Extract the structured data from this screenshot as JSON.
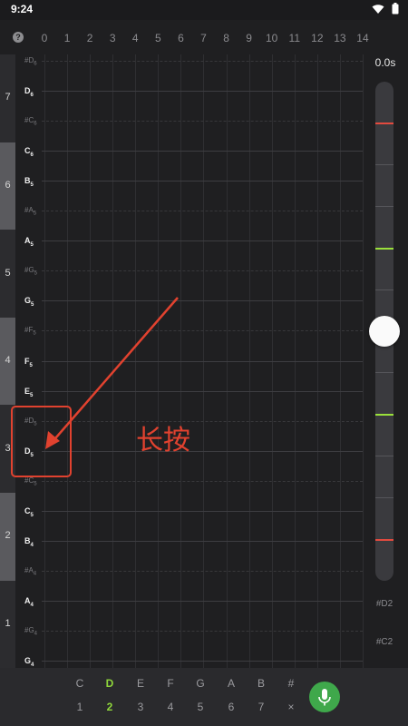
{
  "status_bar": {
    "time": "9:24"
  },
  "fret_header": {
    "help": "?",
    "frets": [
      "0",
      "1",
      "2",
      "3",
      "4",
      "5",
      "6",
      "7",
      "8",
      "9",
      "10",
      "11",
      "12",
      "13",
      "14"
    ]
  },
  "octaves": [
    "7",
    "6",
    "5",
    "4",
    "3",
    "2",
    "1"
  ],
  "notes": [
    {
      "name": "#D",
      "octave": "6",
      "sharp": true
    },
    {
      "name": "D",
      "octave": "6",
      "sharp": false
    },
    {
      "name": "#C",
      "octave": "6",
      "sharp": true
    },
    {
      "name": "C",
      "octave": "6",
      "sharp": false
    },
    {
      "name": "B",
      "octave": "5",
      "sharp": false
    },
    {
      "name": "#A",
      "octave": "5",
      "sharp": true
    },
    {
      "name": "A",
      "octave": "5",
      "sharp": false
    },
    {
      "name": "#G",
      "octave": "5",
      "sharp": true
    },
    {
      "name": "G",
      "octave": "5",
      "sharp": false
    },
    {
      "name": "#F",
      "octave": "5",
      "sharp": true
    },
    {
      "name": "F",
      "octave": "5",
      "sharp": false
    },
    {
      "name": "E",
      "octave": "5",
      "sharp": false
    },
    {
      "name": "#D",
      "octave": "5",
      "sharp": true
    },
    {
      "name": "D",
      "octave": "5",
      "sharp": false
    },
    {
      "name": "#C",
      "octave": "5",
      "sharp": true
    },
    {
      "name": "C",
      "octave": "5",
      "sharp": false
    },
    {
      "name": "B",
      "octave": "4",
      "sharp": false
    },
    {
      "name": "#A",
      "octave": "4",
      "sharp": true
    },
    {
      "name": "A",
      "octave": "4",
      "sharp": false
    },
    {
      "name": "#G",
      "octave": "4",
      "sharp": true
    },
    {
      "name": "G",
      "octave": "4",
      "sharp": false
    }
  ],
  "timer": {
    "value": "0.0s"
  },
  "right_notes": [
    "#D2",
    "#C2"
  ],
  "key_row": {
    "items": [
      "C",
      "D",
      "E",
      "F",
      "G",
      "A",
      "B",
      "#"
    ],
    "selected": "D"
  },
  "number_row": {
    "items": [
      "1",
      "2",
      "3",
      "4",
      "5",
      "6",
      "7",
      "×"
    ],
    "selected": "2"
  },
  "annotation": {
    "text": "长按"
  },
  "colors": {
    "accent_green": "#8fd63b",
    "mic_green": "#3fa84b",
    "marker_red": "#e24a3f",
    "annotation_red": "#e1422f"
  }
}
